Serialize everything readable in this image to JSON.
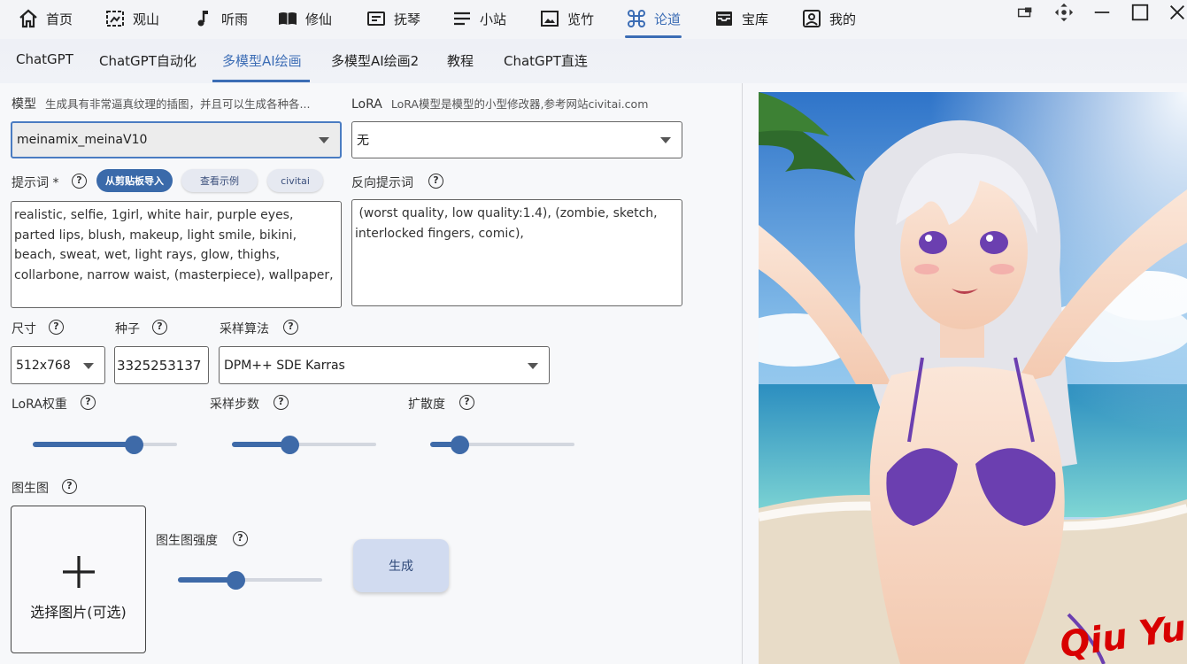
{
  "nav": {
    "items": [
      {
        "label": "首页",
        "icon": "home-icon"
      },
      {
        "label": "观山",
        "icon": "frame-icon"
      },
      {
        "label": "听雨",
        "icon": "music-note-icon"
      },
      {
        "label": "修仙",
        "icon": "book-icon"
      },
      {
        "label": "抚琴",
        "icon": "note-icon"
      },
      {
        "label": "小站",
        "icon": "menu-lines-icon"
      },
      {
        "label": "览竹",
        "icon": "image-icon"
      },
      {
        "label": "论道",
        "icon": "command-icon"
      },
      {
        "label": "宝库",
        "icon": "inbox-icon"
      },
      {
        "label": "我的",
        "icon": "account-box-icon"
      }
    ],
    "active": "论道"
  },
  "window_controls": [
    "pin-icon",
    "move-icon",
    "minimize-icon",
    "maximize-icon",
    "close-icon"
  ],
  "subtabs": {
    "items": [
      "ChatGPT",
      "ChatGPT自动化",
      "多模型AI绘画",
      "多模型AI绘画2",
      "教程",
      "ChatGPT直连"
    ],
    "active": "多模型AI绘画"
  },
  "form": {
    "model_label": "模型",
    "model_hint": "生成具有非常逼真纹理的插图，并且可以生成各种各...",
    "model_value": "meinamix_meinaV10",
    "lora_label": "LoRA",
    "lora_hint": "LoRA模型是模型的小型修改器,参考网站civitai.com",
    "lora_value": "无",
    "prompt_label": "提示词 *",
    "paste_button": "从剪贴板导入",
    "example_button": "查看示例",
    "civitai_button": "civitai",
    "prompt_value": "realistic, selfie, 1girl, white hair, purple eyes, parted lips, blush, makeup, light smile, bikini, beach, sweat, wet, light rays, glow, thighs, collarbone, narrow waist, (masterpiece), wallpaper,",
    "negative_label": "反向提示词",
    "negative_value": " (worst quality, low quality:1.4), (zombie, sketch, interlocked fingers, comic),",
    "size_label": "尺寸",
    "size_value": "512x768",
    "seed_label": "种子",
    "seed_value": "3325253137",
    "sampler_label": "采样算法",
    "sampler_value": "DPM++ SDE Karras",
    "lora_weight_label": "LoRA权重",
    "lora_weight_level": 0.7,
    "steps_label": "采样步数",
    "steps_level": 0.4,
    "cfg_label": "扩散度",
    "cfg_level": 0.2,
    "img2img_label": "图生图",
    "upload_label": "选择图片(可选)",
    "img2img_strength_label": "图生图强度",
    "img2img_strength_level": 0.4,
    "generate_button": "生成"
  },
  "preview": {
    "watermark": "Qiu Yue",
    "colors": {
      "sky": "#4a8fd8",
      "sea": "#3fb4c4",
      "sand": "#e8dcc8",
      "hair": "#e4e4ea",
      "bikini": "#6b3fb0",
      "watermark": "#d80000"
    }
  }
}
